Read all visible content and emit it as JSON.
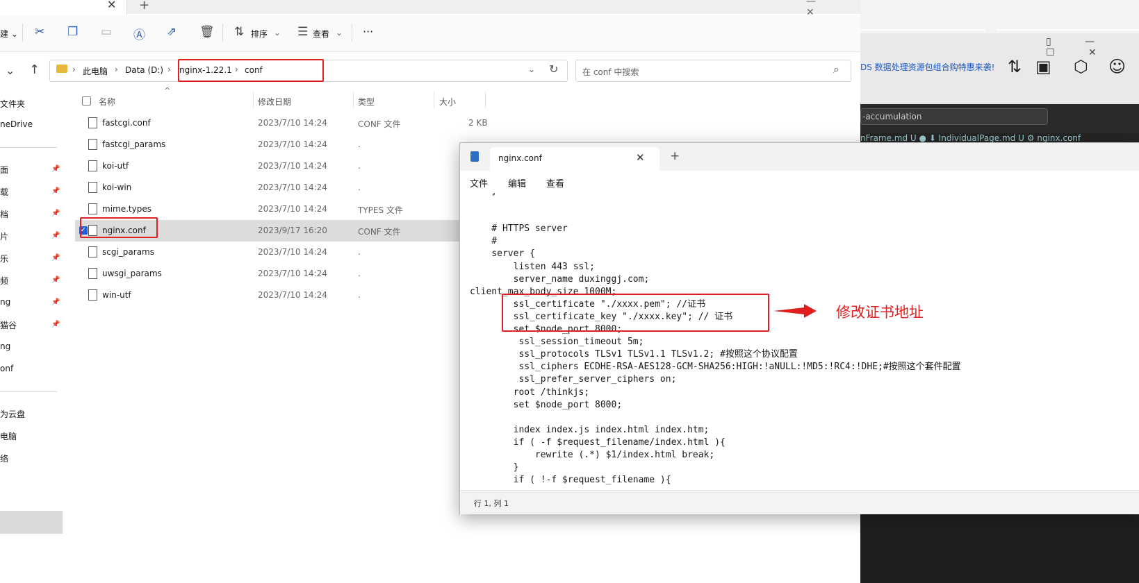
{
  "explorer": {
    "tab_close": "✕",
    "tab_add": "+",
    "toolbar": {
      "sort_label": "排序",
      "view_label": "查看",
      "more_label": "···"
    },
    "breadcrumb": [
      "此电脑",
      "Data (D:)",
      "nginx-1.22.1",
      "conf"
    ],
    "search_placeholder": "在 conf 中搜索",
    "sidebar": [
      {
        "label": "文件夹",
        "pinned": false
      },
      {
        "label": "neDrive",
        "pinned": false
      },
      {
        "label": "面",
        "pinned": true
      },
      {
        "label": "载",
        "pinned": true
      },
      {
        "label": "档",
        "pinned": true
      },
      {
        "label": "片",
        "pinned": true
      },
      {
        "label": "乐",
        "pinned": true
      },
      {
        "label": "频",
        "pinned": true
      },
      {
        "label": "ng",
        "pinned": true
      },
      {
        "label": "猫谷",
        "pinned": true
      },
      {
        "label": "ng",
        "pinned": false
      },
      {
        "label": "onf",
        "pinned": false
      },
      {
        "label": "为云盘",
        "pinned": false
      },
      {
        "label": "电脑",
        "pinned": false
      },
      {
        "label": "络",
        "pinned": false
      }
    ],
    "columns": {
      "name": "名称",
      "date": "修改日期",
      "type": "类型",
      "size": "大小"
    },
    "files": [
      {
        "name": "fastcgi.conf",
        "date": "2023/7/10 14:24",
        "type": "CONF 文件",
        "size": "2 KB"
      },
      {
        "name": "fastcgi_params",
        "date": "2023/7/10 14:24",
        "type": ".",
        "size": ""
      },
      {
        "name": "koi-utf",
        "date": "2023/7/10 14:24",
        "type": ".",
        "size": ""
      },
      {
        "name": "koi-win",
        "date": "2023/7/10 14:24",
        "type": ".",
        "size": ""
      },
      {
        "name": "mime.types",
        "date": "2023/7/10 14:24",
        "type": "TYPES 文件",
        "size": ""
      },
      {
        "name": "nginx.conf",
        "date": "2023/9/17 16:20",
        "type": "CONF 文件",
        "size": "",
        "selected": true
      },
      {
        "name": "scgi_params",
        "date": "2023/7/10 14:24",
        "type": ".",
        "size": ""
      },
      {
        "name": "uwsgi_params",
        "date": "2023/7/10 14:24",
        "type": ".",
        "size": ""
      },
      {
        "name": "win-utf",
        "date": "2023/7/10 14:24",
        "type": ".",
        "size": ""
      }
    ]
  },
  "notepad": {
    "tab_title": "nginx.conf",
    "tab_close": "✕",
    "tab_add": "+",
    "menu": [
      "文件",
      "编辑",
      "查看"
    ],
    "code_lines": [
      "    }",
      "",
      "",
      "    # HTTPS server",
      "    #",
      "    server {",
      "        listen 443 ssl;",
      "        server_name duxinggj.com;",
      "client_max_body_size 1000M;",
      "        ssl_certificate \"./xxxx.pem\"; //证书",
      "        ssl_certificate_key \"./xxxx.key\"; // 证书",
      "        set $node_port 8000;",
      "         ssl_session_timeout 5m;",
      "         ssl_protocols TLSv1 TLSv1.1 TLSv1.2; #按照这个协议配置",
      "         ssl_ciphers ECDHE-RSA-AES128-GCM-SHA256:HIGH:!aNULL:!MD5:!RC4:!DHE;#按照这个套件配置",
      "         ssl_prefer_server_ciphers on;",
      "        root /thinkjs;",
      "        set $node_port 8000;",
      "",
      "        index index.js index.html index.htm;",
      "        if ( -f $request_filename/index.html ){",
      "            rewrite (.*) $1/index.html break;",
      "        }",
      "        if ( !-f $request_filename ){"
    ],
    "status_position": "行 1, 列 1"
  },
  "annotation": {
    "text": "修改证书地址",
    "color": "#e02020"
  },
  "background_app": {
    "promo_text": "DS 数据处理资源包组合购特惠来袭!",
    "search_text": "-accumulation",
    "tabs_text": "nFrame.md U  ●   ⬇ IndividualPage.md U    ⚙ nginx.conf"
  },
  "colors": {
    "accent": "#1a5fd8",
    "annotation_red": "#e02020",
    "folder": "#e8b83a"
  }
}
